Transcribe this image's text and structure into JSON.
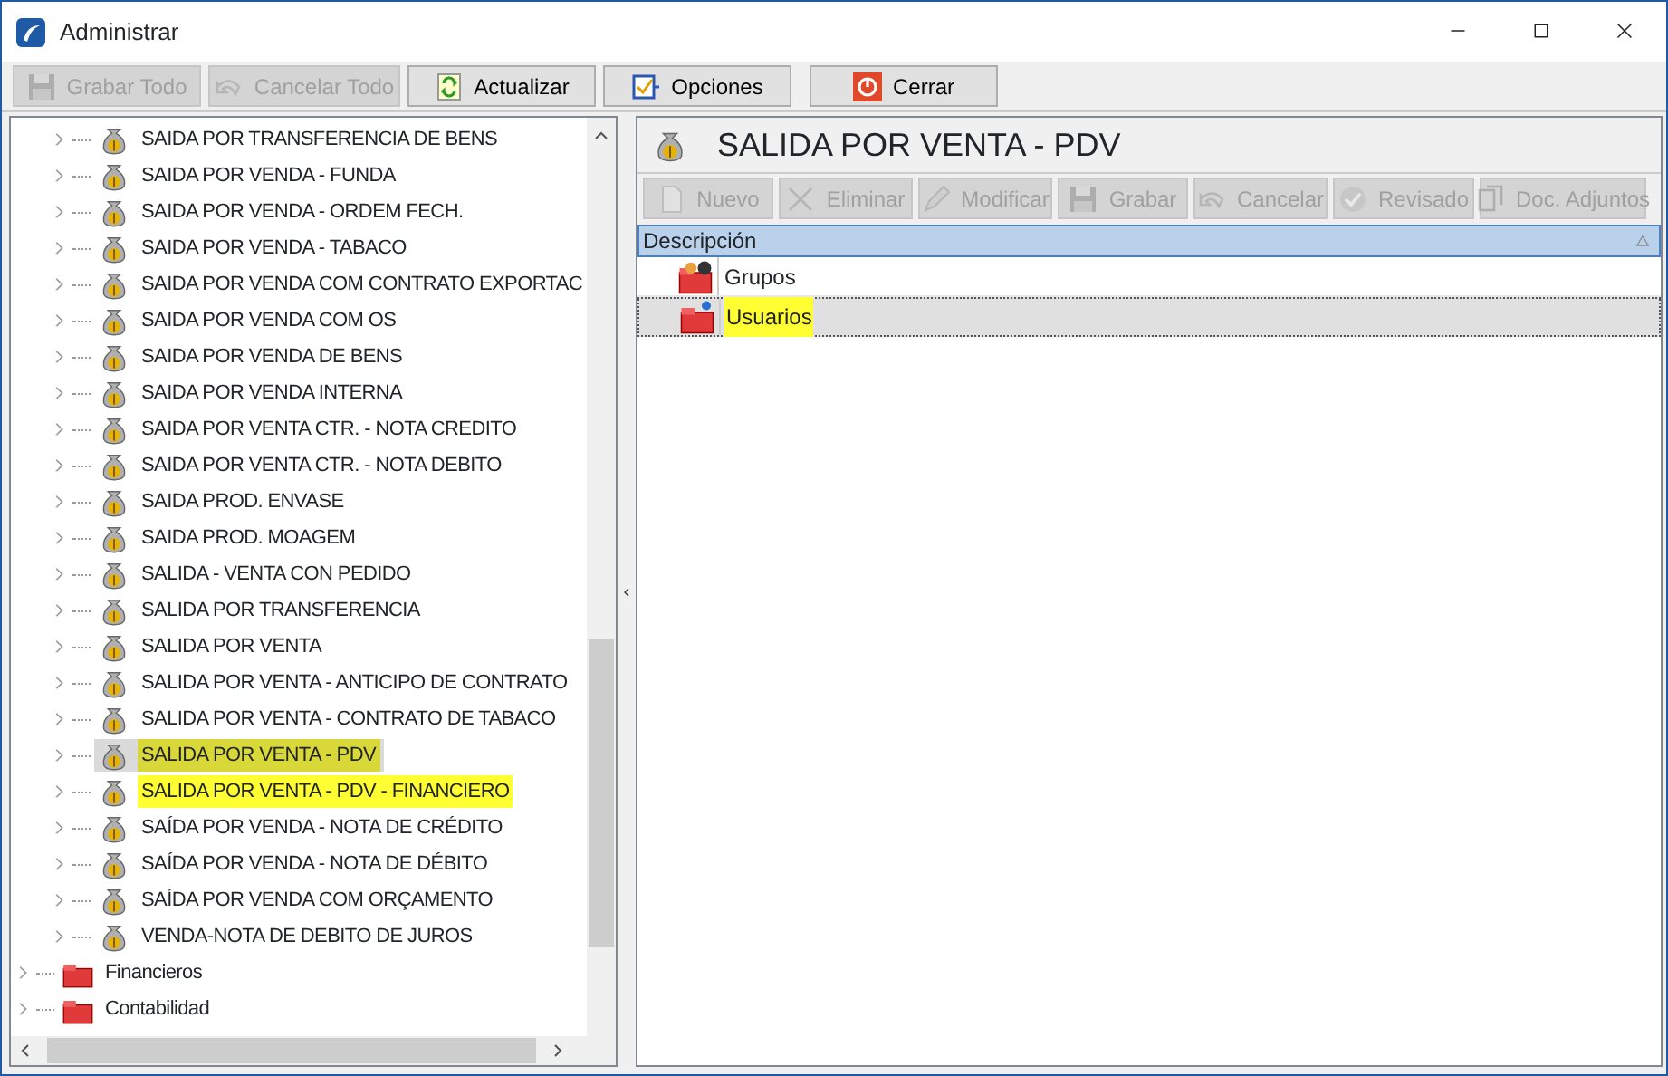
{
  "window": {
    "title": "Administrar"
  },
  "toolbar": [
    {
      "label": "Grabar Todo",
      "kind": "save",
      "disabled": true
    },
    {
      "label": "Cancelar Todo",
      "kind": "undo",
      "disabled": true
    },
    {
      "label": "Actualizar",
      "kind": "refresh",
      "disabled": false
    },
    {
      "label": "Opciones",
      "kind": "options",
      "disabled": false
    },
    {
      "label": "Cerrar",
      "kind": "close",
      "disabled": false
    }
  ],
  "tree": {
    "children": [
      {
        "label": "SAIDA POR TRANSFERENCIA DE BENS",
        "selected": false,
        "highlighted": false
      },
      {
        "label": "SAIDA POR VENDA - FUNDA",
        "selected": false,
        "highlighted": false
      },
      {
        "label": "SAIDA POR VENDA - ORDEM FECH.",
        "selected": false,
        "highlighted": false
      },
      {
        "label": "SAIDA POR VENDA - TABACO",
        "selected": false,
        "highlighted": false
      },
      {
        "label": "SAIDA POR VENDA COM CONTRATO EXPORTAC",
        "selected": false,
        "highlighted": false
      },
      {
        "label": "SAIDA POR VENDA COM OS",
        "selected": false,
        "highlighted": false
      },
      {
        "label": "SAIDA POR VENDA DE BENS",
        "selected": false,
        "highlighted": false
      },
      {
        "label": "SAIDA POR VENDA INTERNA",
        "selected": false,
        "highlighted": false
      },
      {
        "label": "SAIDA POR VENTA CTR. - NOTA CREDITO",
        "selected": false,
        "highlighted": false
      },
      {
        "label": "SAIDA POR VENTA CTR. - NOTA DEBITO",
        "selected": false,
        "highlighted": false
      },
      {
        "label": "SAIDA PROD. ENVASE",
        "selected": false,
        "highlighted": false
      },
      {
        "label": "SAIDA PROD. MOAGEM",
        "selected": false,
        "highlighted": false
      },
      {
        "label": "SALIDA - VENTA CON PEDIDO",
        "selected": false,
        "highlighted": false
      },
      {
        "label": "SALIDA POR TRANSFERENCIA",
        "selected": false,
        "highlighted": false
      },
      {
        "label": "SALIDA POR VENTA",
        "selected": false,
        "highlighted": false
      },
      {
        "label": "SALIDA POR VENTA - ANTICIPO DE CONTRATO",
        "selected": false,
        "highlighted": false
      },
      {
        "label": "SALIDA POR VENTA - CONTRATO DE TABACO",
        "selected": false,
        "highlighted": false
      },
      {
        "label": "SALIDA POR VENTA - PDV",
        "selected": true,
        "highlighted": true
      },
      {
        "label": "SALIDA POR VENTA - PDV - FINANCIERO",
        "selected": false,
        "highlighted": true
      },
      {
        "label": "SAÍDA POR VENDA - NOTA DE CRÉDITO",
        "selected": false,
        "highlighted": false
      },
      {
        "label": "SAÍDA POR VENDA - NOTA DE DÉBITO",
        "selected": false,
        "highlighted": false
      },
      {
        "label": "SAÍDA POR VENDA COM ORÇAMENTO",
        "selected": false,
        "highlighted": false
      },
      {
        "label": "VENDA-NOTA DE DEBITO DE JUROS",
        "selected": false,
        "highlighted": false
      }
    ],
    "items": [
      {
        "label": "Financieros",
        "selected": false
      },
      {
        "label": "Contabilidad",
        "selected": false
      }
    ]
  },
  "detail": {
    "title": "SALIDA POR VENTA - PDV",
    "toolbar": [
      {
        "label": "Nuevo",
        "kind": "new",
        "disabled": true
      },
      {
        "label": "Eliminar",
        "kind": "delete",
        "disabled": true
      },
      {
        "label": "Modificar",
        "kind": "edit",
        "disabled": true
      },
      {
        "label": "Grabar",
        "kind": "save",
        "disabled": true
      },
      {
        "label": "Cancelar",
        "kind": "undo",
        "disabled": true
      },
      {
        "label": "Revisado",
        "kind": "check",
        "disabled": true
      },
      {
        "label": "Doc. Adjuntos",
        "kind": "attach",
        "disabled": true
      }
    ],
    "table": {
      "columns": [
        "Descripción"
      ],
      "rows": [
        {
          "label": "Grupos",
          "kind": "group",
          "selected": false
        },
        {
          "label": "Usuarios",
          "kind": "user",
          "selected": true
        }
      ]
    }
  }
}
